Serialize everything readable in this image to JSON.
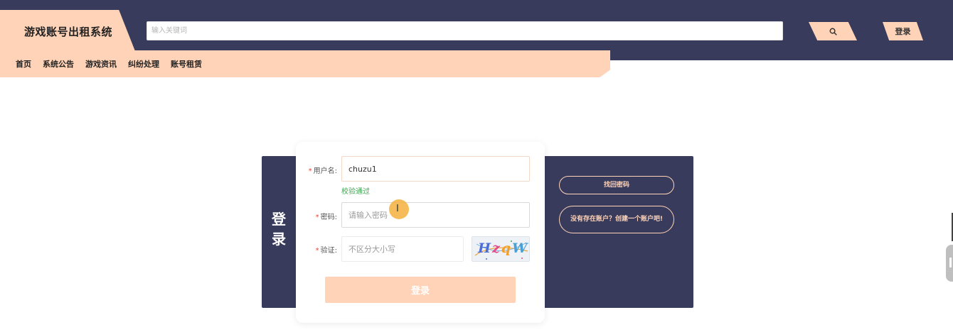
{
  "header": {
    "brand_title": "游戏账号出租系统",
    "search_placeholder": "输入关键词",
    "search_icon": "search-icon",
    "login_label": "登录"
  },
  "nav": {
    "items": [
      "首页",
      "系统公告",
      "游戏资讯",
      "纠纷处理",
      "账号租赁"
    ]
  },
  "login": {
    "title_line1": "登",
    "title_line2": "录",
    "username_label": "用户名:",
    "username_value": "chuzu1",
    "username_valid_msg": "校验通过",
    "password_label": "密码:",
    "password_placeholder": "请输入密码",
    "captcha_label": "验证:",
    "captcha_placeholder": "不区分大小写",
    "captcha_chars": [
      "H",
      "z",
      "q",
      "W"
    ],
    "submit_label": "登录",
    "forgot_label": "找回密码",
    "register_label": "没有存在账户？创建一个账户吧!"
  },
  "colors": {
    "dark": "#383b5b",
    "accent": "#ffd3b8",
    "success": "#3ca650",
    "required": "#e0453a"
  }
}
